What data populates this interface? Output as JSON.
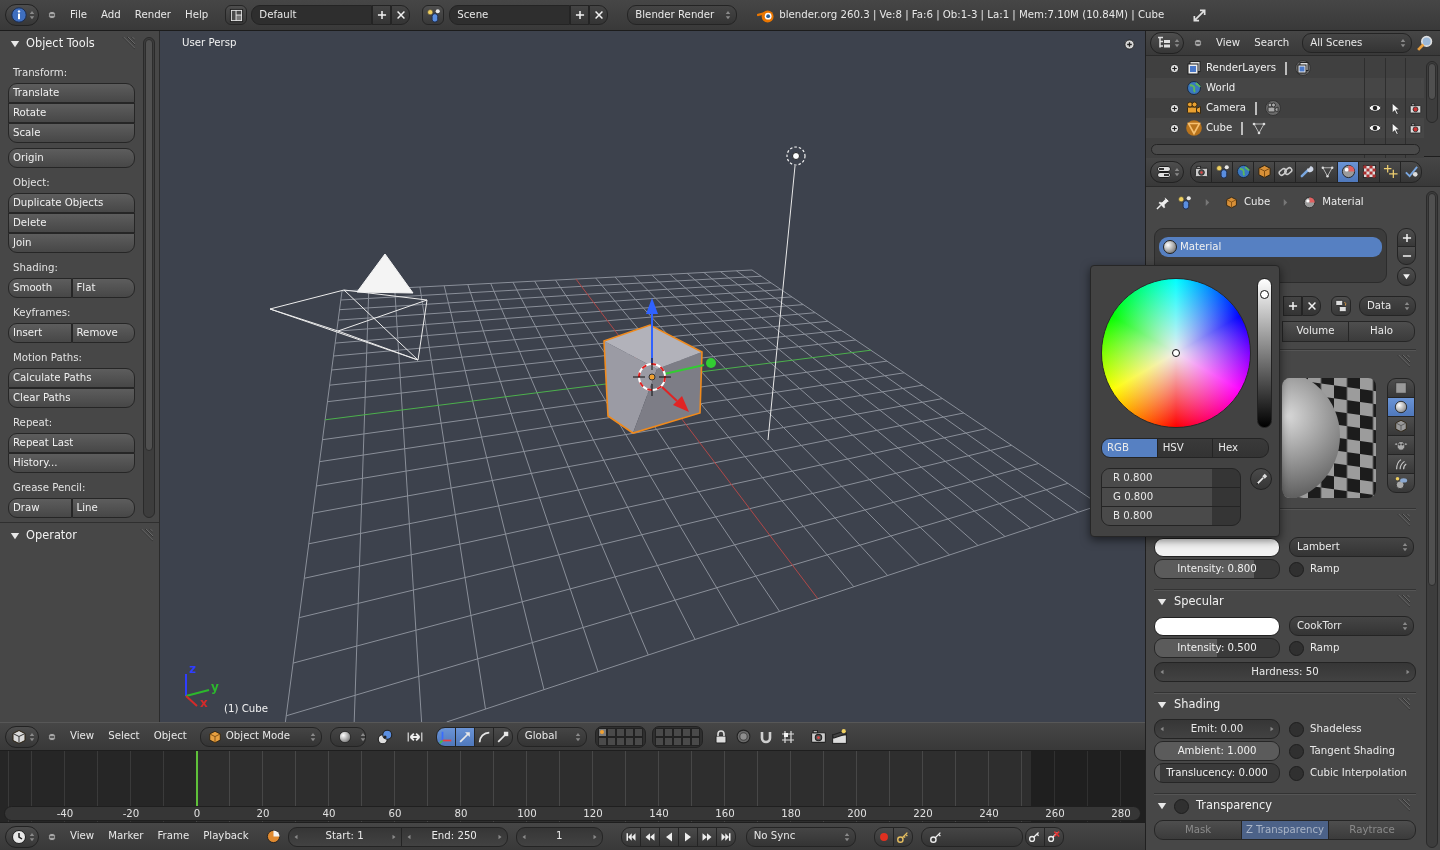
{
  "top_bar": {
    "menus": [
      "File",
      "Add",
      "Render",
      "Help"
    ],
    "screen_layout": "Default",
    "scene": "Scene",
    "render_engine": "Blender Render",
    "stats": "blender.org 260.3 | Ve:8 | Fa:6 | Ob:1-3 | La:1 | Mem:7.10M (10.84M) | Cube"
  },
  "tool_shelf": {
    "panels": [
      {
        "title": "Object Tools",
        "expanded": true,
        "groups": [
          {
            "label": "Transform:",
            "kind": "column",
            "buttons": [
              "Translate",
              "Rotate",
              "Scale"
            ]
          },
          {
            "kind": "column",
            "buttons": [
              "Origin"
            ]
          },
          {
            "label": "Object:",
            "kind": "column",
            "buttons": [
              "Duplicate Objects",
              "Delete",
              "Join"
            ]
          },
          {
            "label": "Shading:",
            "kind": "row",
            "buttons": [
              "Smooth",
              "Flat"
            ]
          },
          {
            "label": "Keyframes:",
            "kind": "row",
            "buttons": [
              "Insert",
              "Remove"
            ]
          },
          {
            "label": "Motion Paths:",
            "kind": "column",
            "buttons": [
              "Calculate Paths",
              "Clear Paths"
            ]
          },
          {
            "label": "Repeat:",
            "kind": "column",
            "buttons": [
              "Repeat Last",
              "History..."
            ]
          },
          {
            "label": "Grease Pencil:",
            "kind": "row",
            "buttons": [
              "Draw",
              "Line"
            ]
          }
        ]
      },
      {
        "title": "Operator",
        "expanded": true
      }
    ]
  },
  "viewport": {
    "view_name": "User Persp",
    "object_name": "(1) Cube",
    "axis_labels": [
      {
        "kind": "z",
        "text": "z",
        "color": "#2f3dff"
      },
      {
        "kind": "y",
        "text": "y",
        "color": "#2cb82c"
      },
      {
        "kind": "x",
        "text": "x",
        "color": "#d42a2a"
      }
    ]
  },
  "view3d_header": {
    "menus": [
      "View",
      "Select",
      "Object"
    ],
    "mode": "Object Mode",
    "manipulators": [
      {
        "kind": "toggle",
        "selected": true
      },
      {
        "kind": "translate",
        "selected": true
      },
      {
        "kind": "rotate",
        "selected": false
      },
      {
        "kind": "scale",
        "selected": false
      }
    ],
    "orientation": "Global",
    "layers": [
      {
        "selected": true,
        "has_objects": true
      },
      {
        "selected": false,
        "has_objects": false
      },
      {
        "selected": false,
        "has_objects": false
      },
      {
        "selected": false,
        "has_objects": false
      },
      {
        "selected": false,
        "has_objects": false
      },
      {
        "selected": false,
        "has_objects": false
      },
      {
        "selected": false,
        "has_objects": false
      },
      {
        "selected": false,
        "has_objects": false
      },
      {
        "selected": false,
        "has_objects": false
      },
      {
        "selected": false,
        "has_objects": false
      },
      {
        "selected": false,
        "has_objects": false
      },
      {
        "selected": false,
        "has_objects": false
      },
      {
        "selected": false,
        "has_objects": false
      },
      {
        "selected": false,
        "has_objects": false
      },
      {
        "selected": false,
        "has_objects": false
      },
      {
        "selected": false,
        "has_objects": false
      },
      {
        "selected": false,
        "has_objects": false
      },
      {
        "selected": false,
        "has_objects": false
      },
      {
        "selected": false,
        "has_objects": false
      },
      {
        "selected": false,
        "has_objects": false
      }
    ]
  },
  "timeline": {
    "playhead": {
      "level": 0.172
    },
    "frame_labels": [
      "-40",
      "-20",
      "0",
      "20",
      "40",
      "60",
      "80",
      "100",
      "120",
      "140",
      "160",
      "180",
      "200",
      "220",
      "240",
      "260",
      "280"
    ]
  },
  "timeline_header": {
    "menus": [
      "View",
      "Marker",
      "Frame",
      "Playback"
    ],
    "start": "Start: 1",
    "end": "End: 250",
    "current_frame": "1",
    "sync": "No Sync"
  },
  "outliner": {
    "menus": [
      "View",
      "Search"
    ],
    "display": "All Scenes",
    "items": [
      {
        "kind": "render_layers",
        "name": "RenderLayers",
        "expanded": false,
        "selected": false
      },
      {
        "kind": "world",
        "name": "World",
        "selected": false
      },
      {
        "kind": "camera",
        "name": "Camera",
        "expanded": false,
        "selected": false,
        "visible": true,
        "selectable": true,
        "renderable": true
      },
      {
        "kind": "mesh",
        "name": "Cube",
        "expanded": false,
        "selected": true,
        "visible": true,
        "selectable": true,
        "renderable": true
      }
    ]
  },
  "properties": {
    "tabs": [
      {
        "kind": "render",
        "selected": false
      },
      {
        "kind": "scene",
        "selected": false
      },
      {
        "kind": "world",
        "selected": false
      },
      {
        "kind": "object",
        "selected": false
      },
      {
        "kind": "constraints",
        "selected": false
      },
      {
        "kind": "modifiers",
        "selected": false
      },
      {
        "kind": "data",
        "selected": false
      },
      {
        "kind": "material",
        "selected": true
      },
      {
        "kind": "texture",
        "selected": false
      },
      {
        "kind": "particles",
        "selected": false
      },
      {
        "kind": "physics",
        "selected": false
      }
    ],
    "breadcrumb": [
      {
        "kind": "object",
        "label": "Cube"
      },
      {
        "kind": "material",
        "label": "Material"
      }
    ],
    "material_slots": [
      {
        "name": "Material",
        "selected": true
      }
    ],
    "link": "Data",
    "types": [
      {
        "label": "Volume",
        "selected": false
      },
      {
        "label": "Halo",
        "selected": false
      }
    ],
    "preview_shapes": [
      {
        "kind": "flat",
        "selected": false
      },
      {
        "kind": "sphere",
        "selected": true
      },
      {
        "kind": "cube",
        "selected": false
      },
      {
        "kind": "monkey",
        "selected": false
      },
      {
        "kind": "hair",
        "selected": false
      },
      {
        "kind": "sky",
        "selected": false
      }
    ],
    "diffuse": {
      "color": "#f2f2f2",
      "shader": "Lambert",
      "intensity": {
        "text": "Intensity: 0.800",
        "level": 0.8
      },
      "ramp": {
        "label": "Ramp",
        "checked": false
      }
    },
    "specular": {
      "title": "Specular",
      "expanded": true,
      "color": "#ffffff",
      "shader": "CookTorr",
      "intensity": {
        "text": "Intensity: 0.500",
        "level": 0.5
      },
      "ramp": {
        "label": "Ramp",
        "checked": false
      },
      "hardness": "Hardness: 50"
    },
    "shading": {
      "title": "Shading",
      "expanded": true,
      "rows": [
        {
          "field": {
            "kind": "number",
            "text": "Emit: 0.00"
          },
          "option": {
            "label": "Shadeless",
            "checked": false
          }
        },
        {
          "field": {
            "kind": "slider",
            "text": "Ambient: 1.000",
            "level": 1
          },
          "option": {
            "label": "Tangent Shading",
            "checked": false
          }
        },
        {
          "field": {
            "kind": "slider",
            "text": "Translucency: 0.000",
            "level": 0
          },
          "option": {
            "label": "Cubic Interpolation",
            "checked": false
          }
        }
      ]
    },
    "transparency": {
      "title": "Transparency",
      "expanded": true,
      "enabled": false,
      "methods": [
        {
          "label": "Mask",
          "selected": false
        },
        {
          "label": "Z Transparency",
          "selected": true
        },
        {
          "label": "Raytrace",
          "selected": false
        }
      ]
    }
  },
  "color_picker": {
    "value": {
      "level": 0.93
    },
    "modes": [
      {
        "label": "RGB",
        "selected": true
      },
      {
        "label": "HSV",
        "selected": false
      },
      {
        "label": "Hex",
        "selected": false
      }
    ],
    "channels": [
      {
        "text": "R 0.800",
        "level": 0.8
      },
      {
        "text": "G 0.800",
        "level": 0.8
      },
      {
        "text": "B 0.800",
        "level": 0.8
      }
    ]
  }
}
